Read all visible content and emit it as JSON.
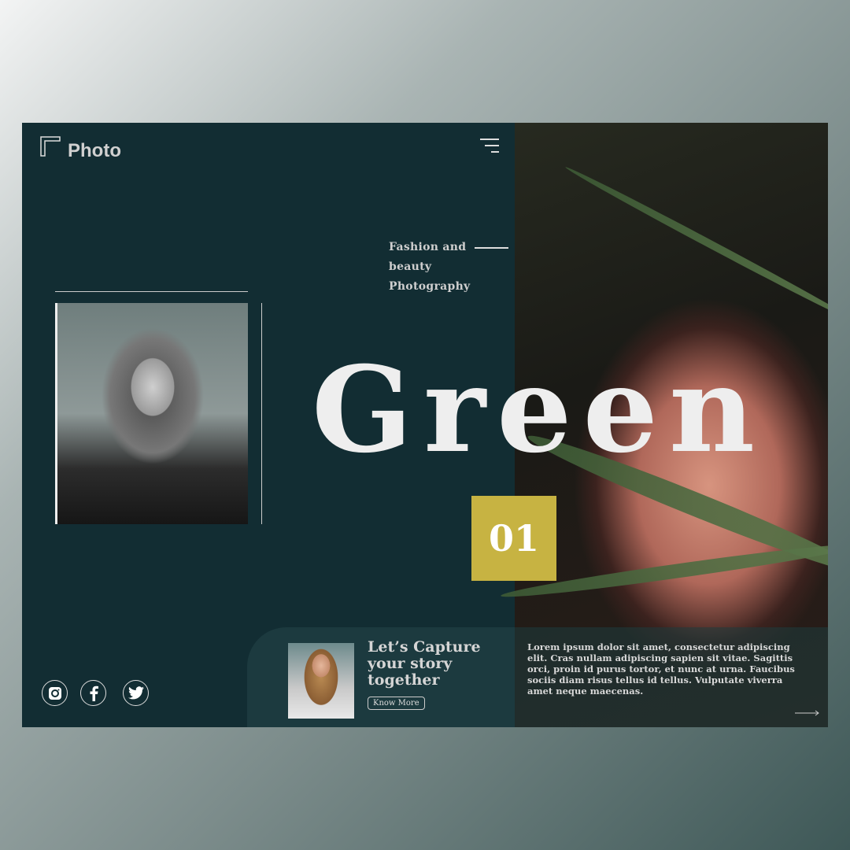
{
  "header": {
    "logo_text": "Photo"
  },
  "hero": {
    "tagline_lines": [
      "Fashion and",
      "beauty",
      "Photography"
    ],
    "title": "Green",
    "number": "01"
  },
  "capture": {
    "title_lines": [
      "Let’s Capture",
      "your story",
      "together"
    ],
    "button": "Know More"
  },
  "description": "Lorem ipsum dolor sit amet, consectetur adipiscing elit. Cras nullam adipiscing sapien sit vitae. Sagittis orci, proin id purus tortor, et nunc at urna. Faucibus sociis diam risus tellus id tellus. Vulputate viverra amet neque maecenas.",
  "social": [
    "instagram-icon",
    "facebook-icon",
    "twitter-icon"
  ],
  "colors": {
    "background": "#122d33",
    "accent": "#c7b342",
    "panel": "#1c3a3f"
  }
}
